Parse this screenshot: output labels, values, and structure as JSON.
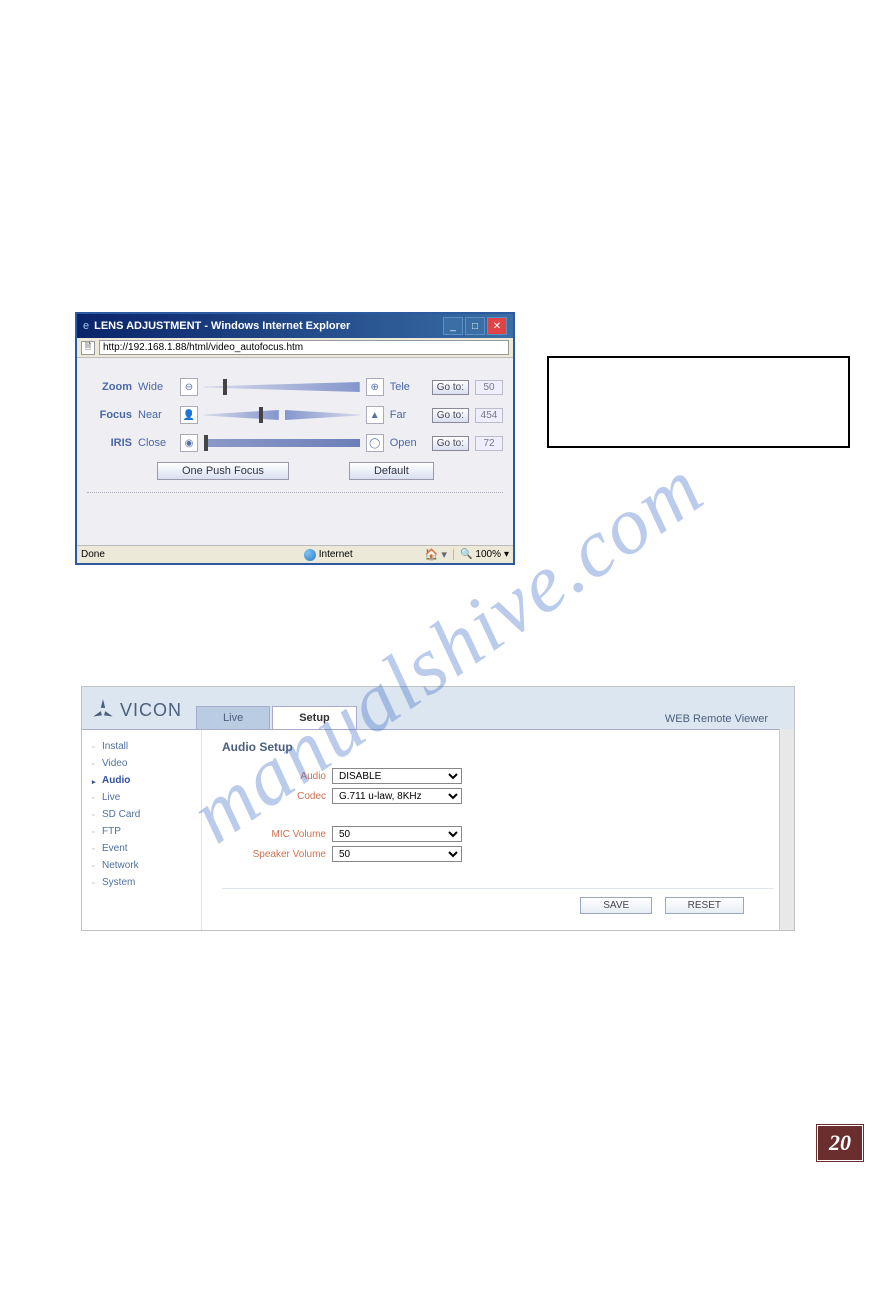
{
  "watermark": "manualshive.com",
  "ie": {
    "title": "LENS ADJUSTMENT - Windows Internet Explorer",
    "url": "http://192.168.1.88/html/video_autofocus.htm",
    "rows": {
      "zoom": {
        "label": "Zoom",
        "left": "Wide",
        "right": "Tele",
        "goto": "Go to:",
        "val": "50",
        "thumb_pct": 12
      },
      "focus": {
        "label": "Focus",
        "left": "Near",
        "right": "Far",
        "goto": "Go to:",
        "val": "454",
        "thumb_pct": 35
      },
      "iris": {
        "label": "IRIS",
        "left": "Close",
        "right": "Open",
        "goto": "Go to:",
        "val": "72",
        "thumb_pct": 0
      }
    },
    "buttons": {
      "one_push": "One Push Focus",
      "default": "Default"
    },
    "status": {
      "done": "Done",
      "zone": "Internet",
      "zoom": "100%"
    }
  },
  "vicon": {
    "logo": "VICON",
    "tabs": {
      "live": "Live",
      "setup": "Setup"
    },
    "brand": "WEB Remote Viewer",
    "sidebar": [
      "Install",
      "Video",
      "Audio",
      "Live",
      "SD Card",
      "FTP",
      "Event",
      "Network",
      "System"
    ],
    "sidebar_active_index": 2,
    "section": "Audio Setup",
    "form": {
      "audio": {
        "label": "Audio",
        "value": "DISABLE"
      },
      "codec": {
        "label": "Codec",
        "value": "G.711 u-law, 8KHz"
      },
      "mic": {
        "label": "MIC Volume",
        "value": "50"
      },
      "speaker": {
        "label": "Speaker Volume",
        "value": "50"
      }
    },
    "buttons": {
      "save": "SAVE",
      "reset": "RESET"
    }
  },
  "page_number": "20"
}
